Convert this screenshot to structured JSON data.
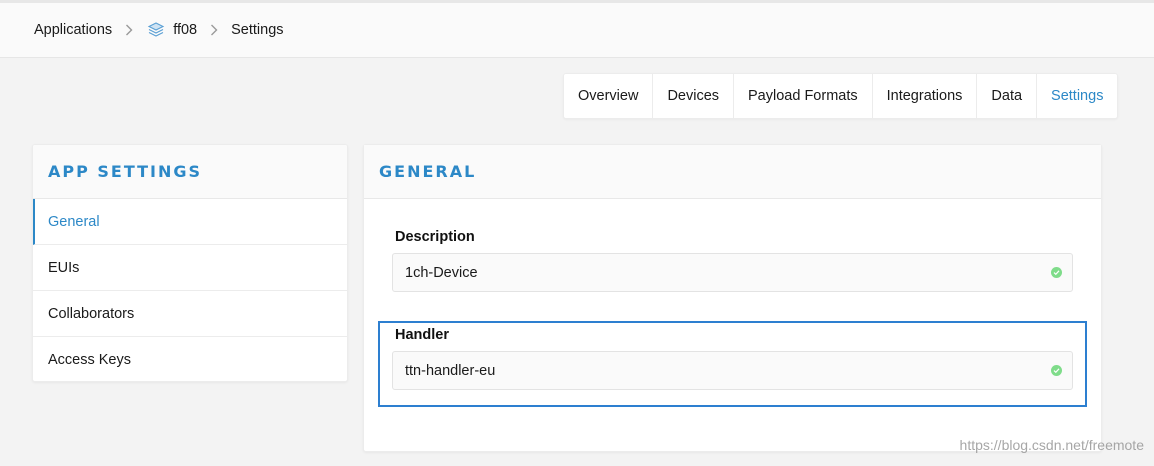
{
  "breadcrumb": {
    "items": [
      "Applications",
      "ff08",
      "Settings"
    ],
    "app_icon": "layers-icon",
    "separator_icon": "chevron-right-icon"
  },
  "tabs": [
    {
      "label": "Overview",
      "active": false
    },
    {
      "label": "Devices",
      "active": false
    },
    {
      "label": "Payload Formats",
      "active": false
    },
    {
      "label": "Integrations",
      "active": false
    },
    {
      "label": "Data",
      "active": false
    },
    {
      "label": "Settings",
      "active": true
    }
  ],
  "sidebar": {
    "title": "APP SETTINGS",
    "items": [
      {
        "label": "General",
        "active": true
      },
      {
        "label": "EUIs",
        "active": false
      },
      {
        "label": "Collaborators",
        "active": false
      },
      {
        "label": "Access Keys",
        "active": false
      }
    ]
  },
  "main": {
    "title": "GENERAL",
    "description": {
      "label": "Description",
      "value": "1ch-Device",
      "status_icon": "valid-check-icon"
    },
    "handler": {
      "label": "Handler",
      "value": "ttn-handler-eu",
      "status_icon": "valid-check-icon"
    }
  },
  "watermark": "https://blog.csdn.net/freemote",
  "colors": {
    "accent": "#2c88c7",
    "highlight": "#2d7fd0",
    "valid": "#7fdc8a"
  }
}
